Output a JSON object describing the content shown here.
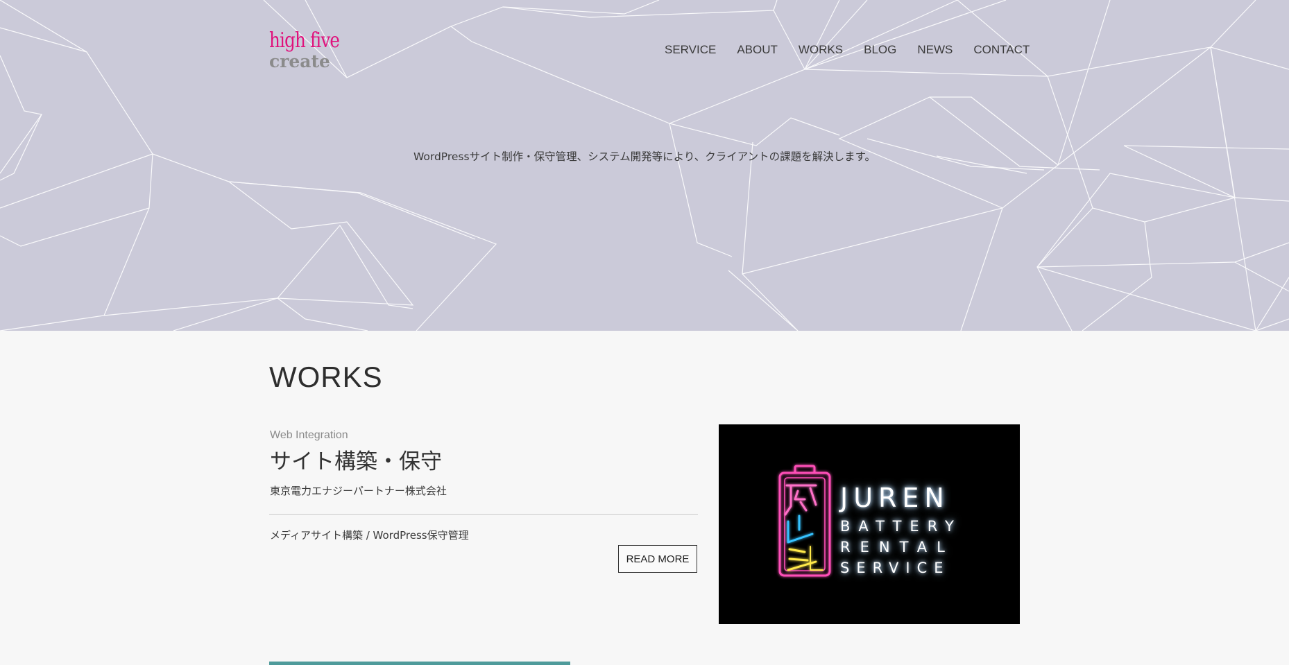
{
  "header": {
    "logo": {
      "line1": "high five",
      "line2": "create"
    },
    "nav": [
      "SERVICE",
      "ABOUT",
      "WORKS",
      "BLOG",
      "NEWS",
      "CONTACT"
    ],
    "tagline": "WordPressサイト制作・保守管理、システム開発等により、クライアントの課題を解決します。"
  },
  "works": {
    "title": "WORKS",
    "item": {
      "category": "Web Integration",
      "title": "サイト構築・保守",
      "client": "東京電力エナジーパートナー株式会社",
      "description": "メディアサイト構築 / WordPress保守管理",
      "read_more": "READ MORE",
      "thumbnail": {
        "line1": "JUREN",
        "line2": "BATTERY",
        "line3": "RENTAL",
        "line4": "SERVICE"
      }
    }
  },
  "colors": {
    "hero_bg": "#cbcad9",
    "logo_pink": "#e0117c",
    "logo_gray": "#8b8b8b",
    "page_bg": "#f7f7f7",
    "accent_bar": "#4f9b9b"
  }
}
